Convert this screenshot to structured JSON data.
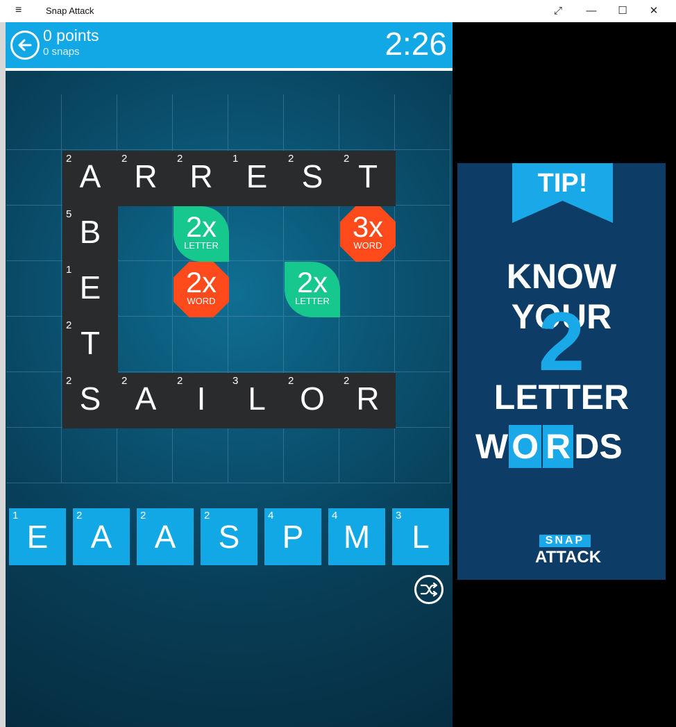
{
  "window": {
    "title": "Snap Attack",
    "menu_icon": "≡",
    "expand_icon": "⤢",
    "minimize_icon": "—",
    "maximize_icon": "☐",
    "close_icon": "✕"
  },
  "header": {
    "points": "0 points",
    "snaps": "0 snaps",
    "timer": "2:26"
  },
  "board": {
    "tiles": [
      {
        "letter": "A",
        "points": "2"
      },
      {
        "letter": "R",
        "points": "2"
      },
      {
        "letter": "R",
        "points": "2"
      },
      {
        "letter": "E",
        "points": "1"
      },
      {
        "letter": "S",
        "points": "2"
      },
      {
        "letter": "T",
        "points": "2"
      },
      {
        "letter": "B",
        "points": "5"
      },
      {
        "letter": "E",
        "points": "1"
      },
      {
        "letter": "T",
        "points": "2"
      },
      {
        "letter": "S",
        "points": "2"
      },
      {
        "letter": "A",
        "points": "2"
      },
      {
        "letter": "I",
        "points": "2"
      },
      {
        "letter": "L",
        "points": "3"
      },
      {
        "letter": "O",
        "points": "2"
      },
      {
        "letter": "R",
        "points": "2"
      }
    ],
    "bonuses": [
      {
        "mult": "2x",
        "kind": "LETTER",
        "color": "#16c78e"
      },
      {
        "mult": "3x",
        "kind": "WORD",
        "color": "#ff4a1c"
      },
      {
        "mult": "2x",
        "kind": "WORD",
        "color": "#ff4a1c"
      },
      {
        "mult": "2x",
        "kind": "LETTER",
        "color": "#16c78e"
      }
    ]
  },
  "rack": [
    {
      "letter": "E",
      "points": "1"
    },
    {
      "letter": "A",
      "points": "2"
    },
    {
      "letter": "A",
      "points": "2"
    },
    {
      "letter": "S",
      "points": "2"
    },
    {
      "letter": "P",
      "points": "4"
    },
    {
      "letter": "M",
      "points": "4"
    },
    {
      "letter": "L",
      "points": "3"
    }
  ],
  "ad": {
    "tip": "TIP!",
    "line1": "KNOW YOUR",
    "big": "2",
    "line3": "LETTER",
    "line4": [
      "W",
      "O",
      "R",
      "DS"
    ],
    "logo_top": "SNAP",
    "logo_bottom": "ATTACK"
  },
  "colors": {
    "accent": "#12a8e6",
    "tile": "#2a2b2d",
    "green_bonus": "#16c78e",
    "orange_bonus": "#ff4a1c"
  }
}
